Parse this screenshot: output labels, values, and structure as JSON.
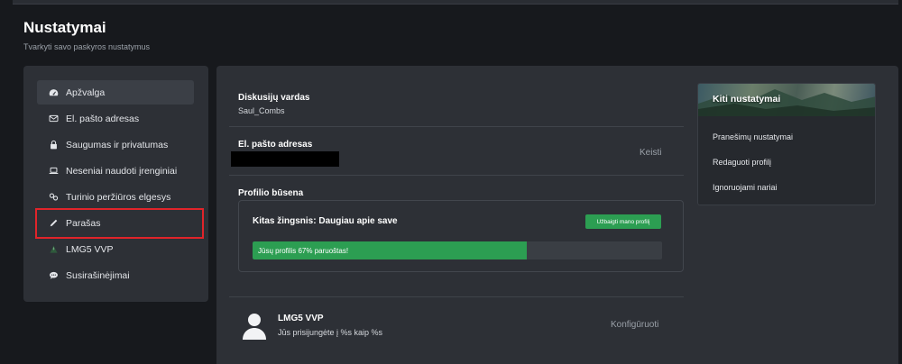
{
  "page": {
    "title": "Nustatymai",
    "subtitle": "Tvarkyti savo paskyros nustatymus"
  },
  "sidebar": {
    "items": [
      {
        "label": "Apžvalga",
        "icon": "dashboard-icon",
        "active": true
      },
      {
        "label": "El. pašto adresas",
        "icon": "envelope-icon"
      },
      {
        "label": "Saugumas ir privatumas",
        "icon": "lock-icon"
      },
      {
        "label": "Neseniai naudoti įrenginiai",
        "icon": "laptop-icon"
      },
      {
        "label": "Turinio peržiūros elgesys",
        "icon": "link-icon"
      },
      {
        "label": "Parašas",
        "icon": "pencil-icon",
        "highlighted": true
      },
      {
        "label": "LMG5 VVP",
        "icon": "lmg5-logo-icon"
      },
      {
        "label": "Susirašinėjimai",
        "icon": "chat-bubble-icon"
      }
    ]
  },
  "main": {
    "username_label": "Diskusijų vardas",
    "username_value": "Saul_Combs",
    "email_label": "El. pašto adresas",
    "email_edit": "Keisti",
    "profile_status_label": "Profilio būsena",
    "next_step": "Kitas žingsnis: Daugiau apie save",
    "finish_button": "Užbaigti mano profilį",
    "progress_text": "Jūsų profilis 67% paruoštas!",
    "progress_percent": 67,
    "connection_name": "LMG5 VVP",
    "connection_sub": "Jūs prisijungėte į %s kaip %s",
    "configure_link": "Konfigūruoti"
  },
  "other": {
    "title": "Kiti nustatymai",
    "links": [
      "Pranešimų nustatymai",
      "Redaguoti profilį",
      "Ignoruojami nariai"
    ]
  },
  "colors": {
    "accent_green": "#2c9e52",
    "highlight_red": "#e0242a",
    "panel": "#2d3036",
    "background": "#17191d"
  }
}
